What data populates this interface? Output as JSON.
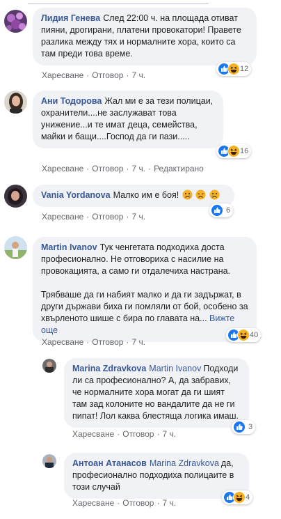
{
  "comments": [
    {
      "author": "Лидия Генева",
      "text": "След 22:00 ч. на площада отиват пияни, дрогирани, платени провокатори! Правете разлика между тях и нормалните хора, които са там преди това време.",
      "like": "Харесване",
      "reply": "Отговор",
      "time": "7 ч.",
      "reactions": "12"
    },
    {
      "author": "Ани Тодорова",
      "text": "Жал ми е за тези полицаи, охранители....не заслужават това унижение...и те имат деца, семейства, майки и бащи....Господ да ги пази.....",
      "like": "Харесване",
      "reply": "Отговор",
      "time": "7 ч.",
      "edited": "Редактирано",
      "reactions": "16"
    },
    {
      "author": "Vania Yordanova",
      "text": "Малко им е боя!",
      "like": "Харесване",
      "reply": "Отговор",
      "time": "7 ч.",
      "reactions": "6"
    },
    {
      "author": "Martin Ivanov",
      "text": "Тук ченгетата подходиха доста професионално. Не отговориха с насилие на провокацията, а само ги отдалечиха настрана.",
      "text2": "Трябваше да ги набият малко и да ги задържат, в други държави биха ги помляли от бой, особено за хвърленото шише с бира по главата на...",
      "more": "Вижте още",
      "like": "Харесване",
      "reply": "Отговор",
      "time": "7 ч.",
      "reactions": "40"
    }
  ],
  "replies": [
    {
      "author": "Marina Zdravkova",
      "mention": "Martin Ivanov",
      "text": "Подходи ли са професионално? А, да забравих, че нормалните хора могат да ги шият там зад колоните но вандалите да не ги пипат! Лол каква блестяща логика имаш.",
      "like": "Харесване",
      "reply": "Отговор",
      "time": "7 ч.",
      "reactions": "3"
    },
    {
      "author": "Антоан Атанасов",
      "mention": "Marina Zdravkova",
      "text": "да, професионално подходиха полицаите в този случай",
      "like": "Харесване",
      "reply": "Отговор",
      "time": "7 ч.",
      "reactions": "4"
    }
  ],
  "colors": {
    "name": "#385898",
    "bubble": "#f0f2f5",
    "meta": "#65676b",
    "like_blue": "#1877f2",
    "haha_yellow": "#f7b125"
  }
}
